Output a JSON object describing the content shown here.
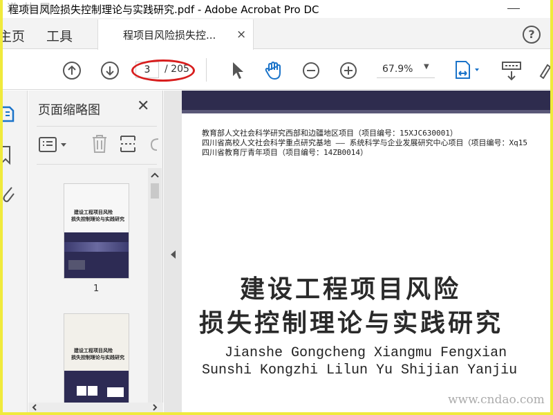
{
  "window": {
    "title": "程项目风险损失控制理论与实践研究.pdf - Adobe Acrobat Pro DC",
    "watermark": "道 林 网"
  },
  "menu": {
    "home_label": "主页",
    "tools_label": "工具"
  },
  "tab": {
    "label": "程项目风险损失控...",
    "close": "×"
  },
  "help": {
    "label": "?"
  },
  "toolbar": {
    "page_current": "3",
    "page_total": "/ 205",
    "zoom": "67.9%",
    "icons": [
      "prev-page-icon",
      "next-page-icon",
      "select-cursor-icon",
      "hand-tool-icon",
      "zoom-out-icon",
      "zoom-in-icon",
      "fit-page-icon",
      "scroll-mode-icon",
      "pen-icon"
    ]
  },
  "thumbnails": {
    "title": "页面缩略图",
    "close": "✕",
    "pages": [
      {
        "label": "1",
        "title_line1": "建设工程项目风险",
        "title_line2": "损失控制理论与实践研究"
      },
      {
        "label": "",
        "title_line1": "建设工程项目风险",
        "title_line2": "损失控制理论与实践研究"
      }
    ]
  },
  "page": {
    "projects": [
      "教育部人文社会科学研究西部和边疆地区项目（项目编号：15XJC630001）",
      "四川省高校人文社会科学重点研究基地 —— 系统科学与企业发展研究中心项目（项目编号：Xq15",
      "四川省教育厅青年项目（项目编号：14ZB0014）"
    ],
    "title_line1": "建设工程项目风险",
    "title_line2": "损失控制理论与实践研究",
    "pinyin_line1": "Jianshe Gongcheng Xiangmu Fengxian",
    "pinyin_line2": "Sunshi Kongzhi Lilun Yu Shijian Yanjiu"
  },
  "site_watermark": "www.cndao.com",
  "colors": {
    "border_frame": "#f0ea3c",
    "annotation_red": "#d81e1e",
    "accent_blue": "#1a73c9",
    "cover_band": "#2e2c4e"
  }
}
